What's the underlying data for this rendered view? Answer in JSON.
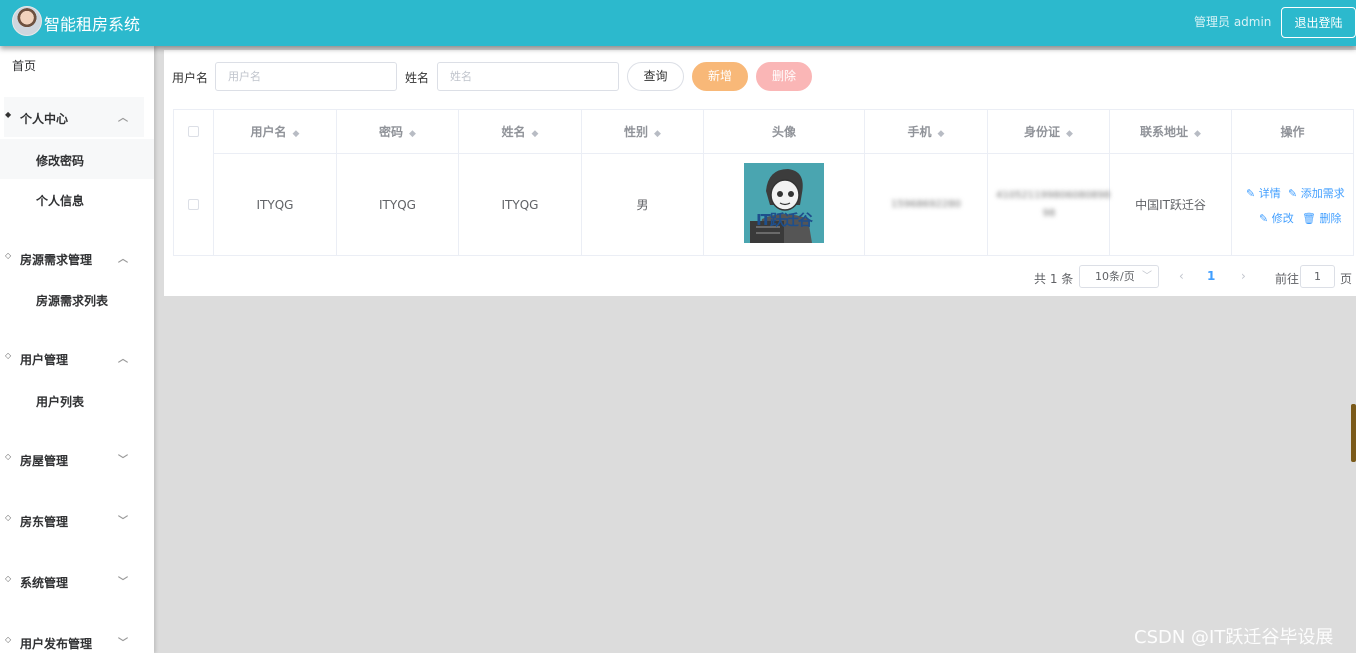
{
  "header": {
    "title": "智能租房系统",
    "admin_label": "管理员 admin",
    "logout_label": "退出登陆"
  },
  "sidebar": {
    "home": "首页",
    "groups": [
      {
        "label": "个人中心",
        "expanded": true,
        "items": [
          "修改密码",
          "个人信息"
        ]
      },
      {
        "label": "房源需求管理",
        "expanded": true,
        "items": [
          "房源需求列表"
        ]
      },
      {
        "label": "用户管理",
        "expanded": true,
        "items": [
          "用户列表"
        ]
      },
      {
        "label": "房屋管理",
        "expanded": false,
        "items": []
      },
      {
        "label": "房东管理",
        "expanded": false,
        "items": []
      },
      {
        "label": "系统管理",
        "expanded": false,
        "items": []
      },
      {
        "label": "用户发布管理",
        "expanded": false,
        "items": []
      }
    ]
  },
  "search": {
    "username_label": "用户名",
    "username_placeholder": "用户名",
    "name_label": "姓名",
    "name_placeholder": "姓名",
    "query_label": "查询",
    "add_label": "新增",
    "delete_label": "删除"
  },
  "table": {
    "columns": [
      "用户名",
      "密码",
      "姓名",
      "性别",
      "头像",
      "手机",
      "身份证",
      "联系地址",
      "操作"
    ],
    "rows": [
      {
        "username": "ITYQG",
        "password": "ITYQG",
        "name": "ITYQG",
        "gender": "男",
        "avatar_text": "IT跃迁谷",
        "phone": "15968692280",
        "id_card": "410521199806080898",
        "id_card_tail": "98",
        "address": "中国IT跃迁谷",
        "actions": {
          "detail": "详情",
          "add_demand": "添加需求",
          "edit": "修改",
          "delete": "删除"
        }
      }
    ]
  },
  "pagination": {
    "total": "共 1 条",
    "page_size": "10条/页",
    "current_page": "1",
    "goto_label": "前往",
    "goto_value": "1",
    "page_unit": "页"
  },
  "watermark": "CSDN @IT跃迁谷毕设展",
  "colors": {
    "header_bg": "#2cb9cd",
    "add_button": "#f8b878",
    "delete_button": "#fab6b6",
    "link": "#409eff"
  }
}
